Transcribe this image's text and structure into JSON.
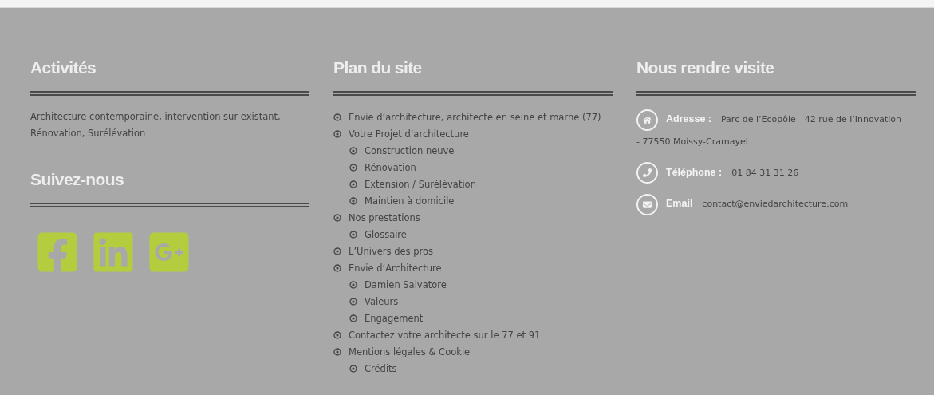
{
  "columns": [
    {
      "kind": "activities",
      "sections": [
        {
          "title": "Activités",
          "text": "Architecture contemporaine, intervention sur existant, Rénovation, Surélévation"
        },
        {
          "title": "Suivez-nous",
          "social": [
            {
              "kind": "facebook"
            },
            {
              "kind": "linkedin"
            },
            {
              "kind": "googleplus"
            }
          ]
        }
      ]
    },
    {
      "kind": "sitemap",
      "title": "Plan du site",
      "items": [
        {
          "label": "Envie d’architecture, architecte en seine et marne (77)"
        },
        {
          "label": "Votre Projet d’architecture",
          "children": [
            {
              "label": "Construction neuve"
            },
            {
              "label": "Rénovation"
            },
            {
              "label": "Extension / Surélévation"
            },
            {
              "label": "Maintien à domicile"
            }
          ]
        },
        {
          "label": "Nos prestations",
          "children": [
            {
              "label": "Glossaire"
            }
          ]
        },
        {
          "label": "L’Univers des pros"
        },
        {
          "label": "Envie d’Architecture",
          "children": [
            {
              "label": "Damien Salvatore"
            },
            {
              "label": "Valeurs"
            },
            {
              "label": "Engagement"
            }
          ]
        },
        {
          "label": "Contactez votre architecte sur le 77 et 91"
        },
        {
          "label": "Mentions légales & Cookie",
          "children": [
            {
              "label": "Crédits"
            }
          ]
        }
      ]
    },
    {
      "kind": "contact",
      "title": "Nous rendre visite",
      "items": [
        {
          "kind": "address",
          "label": "Adresse :",
          "lines": [
            "Parc de l’Ecopôle - 42 rue de l’Innovation",
            "- 77550 Moissy-Cramayel"
          ]
        },
        {
          "kind": "phone",
          "label": "Téléphone :",
          "lines": [
            "01 84 31 31 26"
          ]
        },
        {
          "kind": "email",
          "label": "Email",
          "lines": [
            "contact@enviedarchitecture.com"
          ]
        }
      ]
    }
  ]
}
